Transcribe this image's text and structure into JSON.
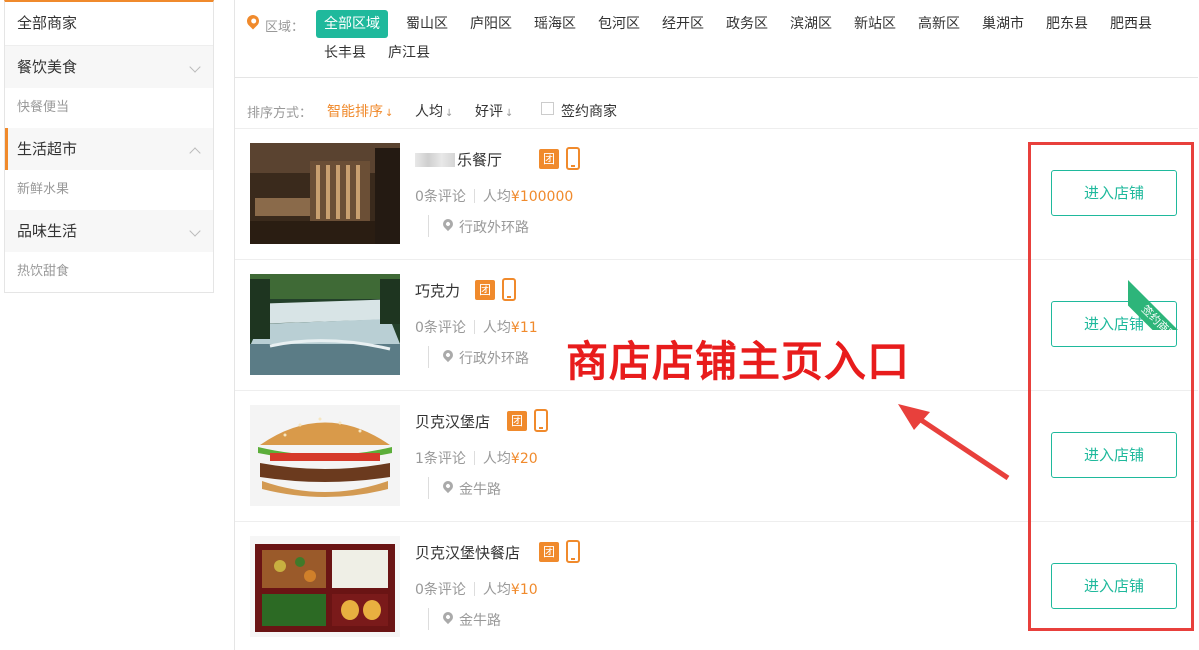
{
  "sidebar": {
    "all_label": "全部商家",
    "categories": [
      {
        "label": "餐饮美食",
        "sub": "快餐便当"
      },
      {
        "label": "生活超市",
        "sub": "新鲜水果"
      },
      {
        "label": "品味生活",
        "sub": "热饮甜食"
      }
    ]
  },
  "filter": {
    "area_label": "区域：",
    "regions": [
      "全部区域",
      "蜀山区",
      "庐阳区",
      "瑶海区",
      "包河区",
      "经开区",
      "政务区",
      "滨湖区",
      "新站区",
      "高新区",
      "巢湖市",
      "肥东县",
      "肥西县",
      "长丰县",
      "庐江县"
    ],
    "selected_region": "全部区域"
  },
  "sort": {
    "label": "排序方式：",
    "options": [
      "智能排序",
      "人均",
      "好评"
    ],
    "arrow": "↓",
    "active": "智能排序",
    "signed_only_label": "签约商家"
  },
  "stores": [
    {
      "name": "乐餐厅",
      "reviews": "0条评论",
      "avg_label": "人均",
      "price": "¥100000",
      "location": "行政外环路",
      "tag": "团",
      "button": "进入店铺"
    },
    {
      "name": "巧克力",
      "reviews": "0条评论",
      "avg_label": "人均",
      "price": "¥11",
      "location": "行政外环路",
      "tag": "团",
      "button": "进入店铺",
      "ribbon": "签约商家"
    },
    {
      "name": "贝克汉堡店",
      "reviews": "1条评论",
      "avg_label": "人均",
      "price": "¥20",
      "location": "金牛路",
      "tag": "团",
      "button": "进入店铺"
    },
    {
      "name": "贝克汉堡快餐店",
      "reviews": "0条评论",
      "avg_label": "人均",
      "price": "¥10",
      "location": "金牛路",
      "tag": "团",
      "button": "进入店铺"
    }
  ],
  "annotation": "商店店铺主页入口",
  "colors": {
    "accent": "#f08a2c",
    "teal": "#1fb99c",
    "annotation_red": "#e81c1c"
  }
}
